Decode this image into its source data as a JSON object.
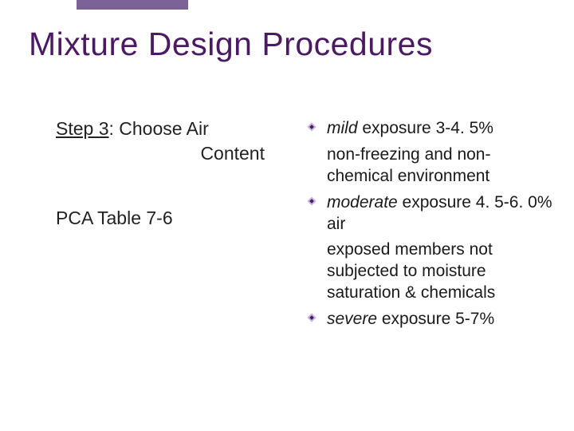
{
  "title": "Mixture Design Procedures",
  "left": {
    "step_label": "Step 3",
    "step_rest": ": Choose Air",
    "step_line2": "Content",
    "pca": "PCA Table 7-6"
  },
  "bullets": [
    {
      "lead_italic": "mild",
      "lead_rest": " exposure 3-4. 5%",
      "sub": "non-freezing and non-chemical environment"
    },
    {
      "lead_italic": "moderate",
      "lead_rest": " exposure 4. 5-6. 0%  air",
      "sub": "exposed members not subjected to moisture saturation & chemicals"
    },
    {
      "lead_italic": "severe",
      "lead_rest": " exposure 5-7%",
      "sub": ""
    }
  ]
}
